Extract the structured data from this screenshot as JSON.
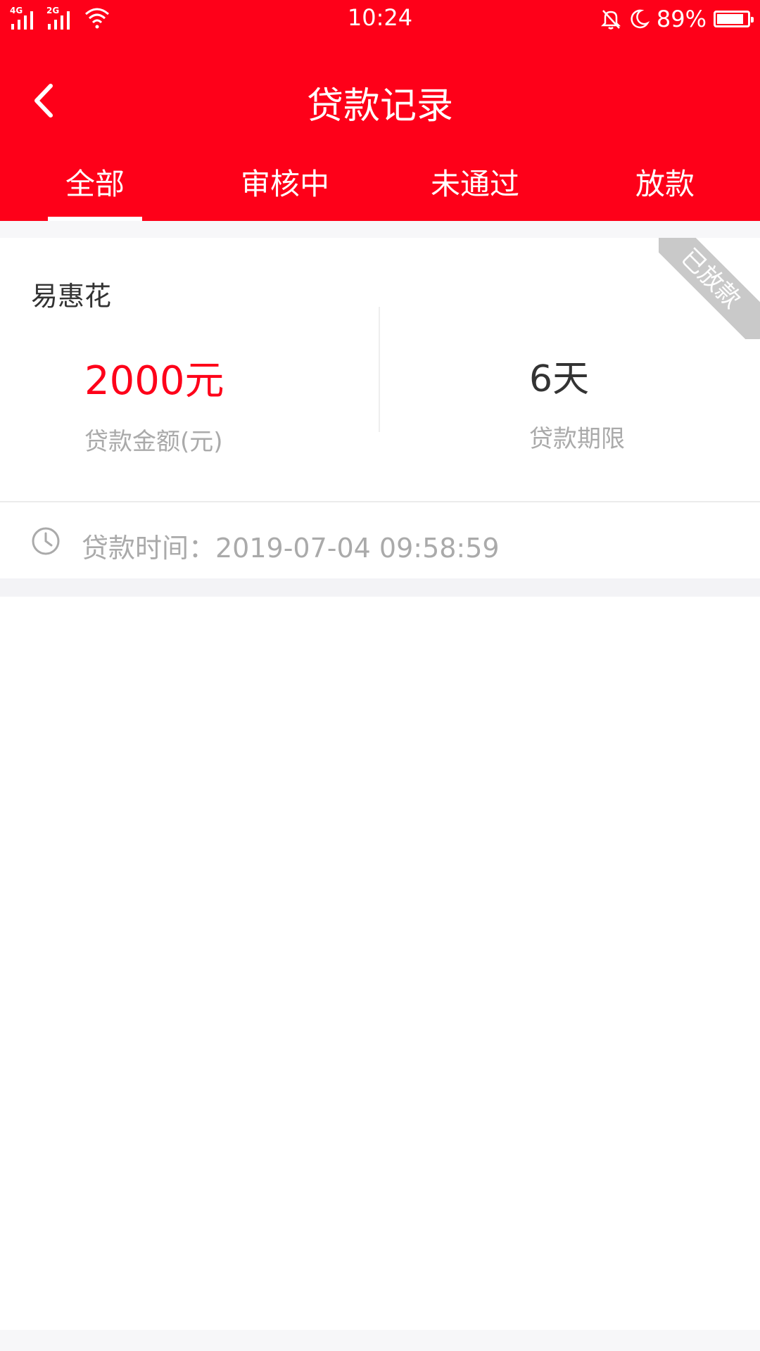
{
  "status_bar": {
    "time": "10:24",
    "battery": "89%",
    "network1": "4G",
    "network2": "2G",
    "icons": [
      "signal-icon",
      "wifi-icon",
      "bell-off-icon",
      "moon-icon",
      "battery-icon"
    ],
    "battery_level": 0.89
  },
  "header": {
    "title": "贷款记录",
    "back_icon": "chevron-left-icon"
  },
  "tabs": [
    {
      "label": "全部",
      "active": true
    },
    {
      "label": "审核中",
      "active": false
    },
    {
      "label": "未通过",
      "active": false
    },
    {
      "label": "放款",
      "active": false
    }
  ],
  "record": {
    "name": "易惠花",
    "status": "已放款",
    "amount": "2000元",
    "amount_label": "贷款金额(元)",
    "term": "6天",
    "term_label": "贷款期限",
    "time": "贷款时间：2019-07-04 09:58:59",
    "time_icon": "clock-icon"
  },
  "colors": {
    "brand": "#fe0019",
    "muted_text": "#aaaaaa",
    "ribbon": "#c9c9c9"
  }
}
